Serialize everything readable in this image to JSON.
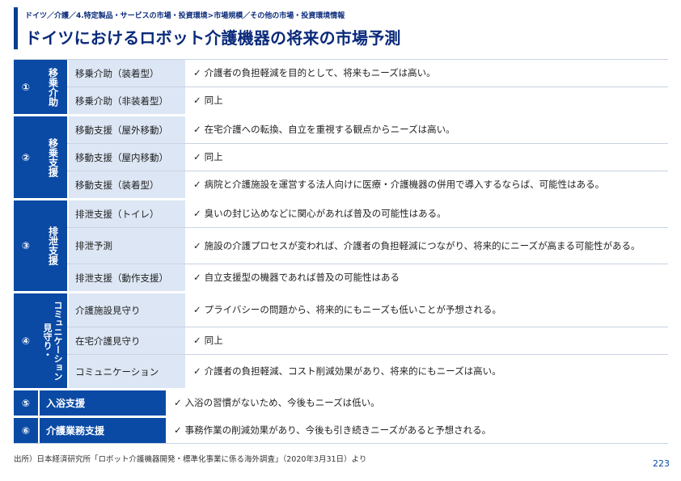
{
  "header": {
    "breadcrumb": "ドイツ／介護／4.特定製品・サービスの市場・投資環境>市場規模／その他の市場・投資環境情報",
    "title": "ドイツにおけるロボット介護機器の将来の市場予測"
  },
  "icons": {
    "check": "check-icon"
  },
  "check_glyph": "✓",
  "groups": [
    {
      "num": "①",
      "category": "移乗介助",
      "rows": [
        {
          "sub": "移乗介助（装着型）",
          "desc": "介護者の負担軽減を目的として、将来もニーズは高い。"
        },
        {
          "sub": "移乗介助（非装着型）",
          "desc": "同上"
        }
      ]
    },
    {
      "num": "②",
      "category": "移乗支援",
      "rows": [
        {
          "sub": "移動支援（屋外移動）",
          "desc": "在宅介護への転換、自立を重視する観点からニーズは高い。"
        },
        {
          "sub": "移動支援（屋内移動）",
          "desc": "同上"
        },
        {
          "sub": "移動支援（装着型）",
          "desc": "病院と介護施設を運営する法人向けに医療・介護機器の併用で導入するならば、可能性はある。"
        }
      ]
    },
    {
      "num": "③",
      "category": "排泄支援",
      "rows": [
        {
          "sub": "排泄支援（トイレ）",
          "desc": "臭いの封じ込めなどに関心があれば普及の可能性はある。"
        },
        {
          "sub": "排泄予測",
          "desc": "施設の介護プロセスが変われば、介護者の負担軽減につながり、将来的にニーズが高まる可能性がある。"
        },
        {
          "sub": "排泄支援（動作支援）",
          "desc": "自立支援型の機器であれば普及の可能性はある"
        }
      ]
    },
    {
      "num": "④",
      "category_col1": "見守り・",
      "category_col2": "コミュニケーション",
      "rows": [
        {
          "sub": "介護施設見守り",
          "desc": "プライバシーの問題から、将来的にもニーズも低いことが予想される。"
        },
        {
          "sub": "在宅介護見守り",
          "desc": "同上"
        },
        {
          "sub": "コミュニケーション",
          "desc": "介護者の負担軽減、コスト削減効果があり、将来的にもニーズは高い。"
        }
      ]
    },
    {
      "num": "⑤",
      "category": "入浴支援",
      "rows": [
        {
          "desc": "入浴の習慣がないため、今後もニーズは低い。"
        }
      ]
    },
    {
      "num": "⑥",
      "category": "介護業務支援",
      "rows": [
        {
          "desc": "事務作業の削減効果があり、今後も引き続きニーズがあると予想される。"
        }
      ]
    }
  ],
  "footer": {
    "source": "出所）日本経済研究所「ロボット介護機器開発・標準化事業に係る海外調査」（2020年3月31日）より",
    "page": "223"
  }
}
